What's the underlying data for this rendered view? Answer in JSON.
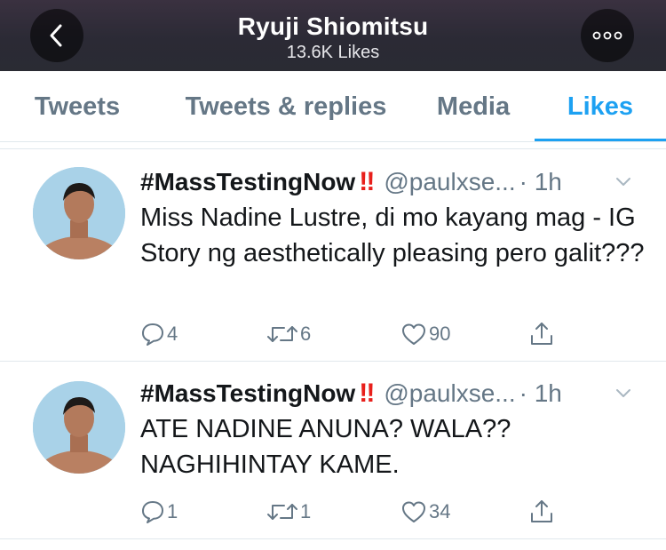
{
  "header": {
    "title": "Ryuji Shiomitsu",
    "subtitle": "13.6K Likes",
    "back_icon": "chevron-left-icon",
    "more_icon": "more-dots-icon"
  },
  "tabs": [
    {
      "label": "Tweets",
      "active": false
    },
    {
      "label": "Tweets & replies",
      "active": false
    },
    {
      "label": "Media",
      "active": false
    },
    {
      "label": "Likes",
      "active": true
    }
  ],
  "colors": {
    "accent": "#1da1f2",
    "muted": "#657786",
    "alert": "#e8201c"
  },
  "tweets": [
    {
      "name": "#MassTestingNow",
      "alert": "‼",
      "handle": "@paulxse...",
      "time": "· 1h",
      "text": "Miss Nadine Lustre, di mo kayang mag - IG Story ng aesthetically pleasing pero galit???",
      "replies": "4",
      "retweets": "6",
      "likes": "90"
    },
    {
      "name": "#MassTestingNow",
      "alert": "‼",
      "handle": "@paulxse...",
      "time": "· 1h",
      "text": "ATE NADINE ANUNA? WALA?? NAGHIHINTAY KAME.",
      "replies": "1",
      "retweets": "1",
      "likes": "34"
    }
  ]
}
